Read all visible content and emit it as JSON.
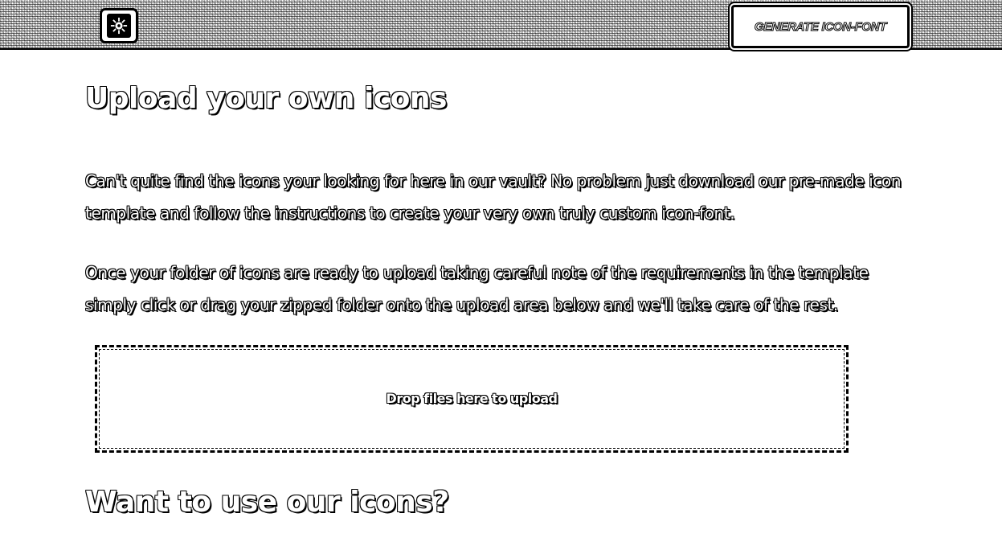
{
  "header": {
    "logo_icon": "gear-cog-icon",
    "generate_button_label": "GENERATE ICON-FONT"
  },
  "upload_section": {
    "heading": "Upload your own icons",
    "paragraph_1": "Can't quite find the icons your looking for here in our vault? No problem just download our pre-made icon template and follow the instructions to create your very own truly custom icon-font.",
    "paragraph_2": "Once your folder of icons are ready to upload taking careful note of the requirements in the template simply click or drag your zipped folder onto the upload area below and we'll take care of the rest.",
    "dropzone_label": "Drop files here to upload"
  },
  "use_section": {
    "heading": "Want to use our icons?"
  }
}
